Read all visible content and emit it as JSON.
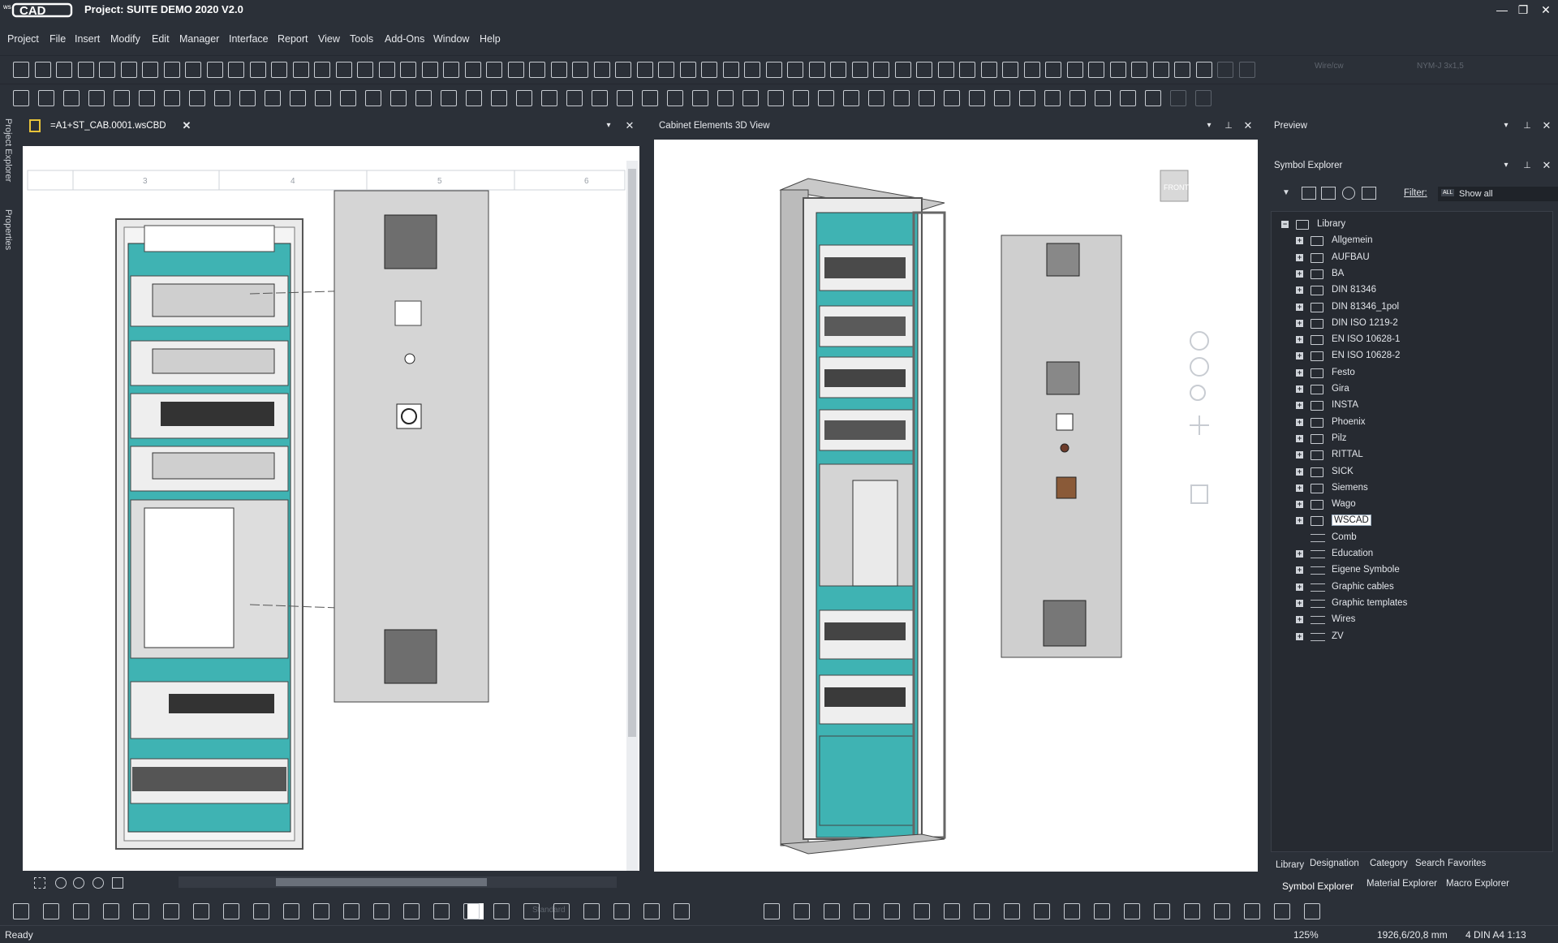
{
  "app": {
    "logo_prefix": "ws",
    "logo_text": "CAD",
    "title": "Project: SUITE DEMO 2020 V2.0"
  },
  "window_controls": {
    "minimize": "—",
    "restore": "❐",
    "close": "✕"
  },
  "menu": [
    "Project",
    "File",
    "Insert",
    "Modify",
    "Edit",
    "Manager",
    "Interface",
    "Report",
    "View",
    "Tools",
    "Add-Ons",
    "Window",
    "Help"
  ],
  "toolbar": {
    "wire_type_placeholder": "Wire/cw",
    "cable_type_placeholder": "NYM-J 3x1,5",
    "layer_placeholder": "Standard"
  },
  "left_dock": {
    "project_explorer": "Project Explorer",
    "properties": "Properties"
  },
  "document": {
    "tab_label": "=A1+ST_CAB.0001.wsCBD",
    "ruler_top": [
      "3",
      "4",
      "5",
      "6"
    ],
    "ruler_inner": [
      "3",
      "4",
      "5",
      "6"
    ]
  },
  "view3d": {
    "title": "Cabinet Elements 3D View",
    "cube_label": "FRONT"
  },
  "preview": {
    "title": "Preview"
  },
  "symbol_explorer": {
    "title": "Symbol Explorer",
    "filter_label": "Filter:",
    "filter_badge": "ALL",
    "filter_value": "Show all",
    "tree": [
      {
        "label": "Library",
        "level": 0,
        "type": "folder",
        "expand": "−"
      },
      {
        "label": "Allgemein",
        "level": 1,
        "type": "folder",
        "expand": "+"
      },
      {
        "label": "AUFBAU",
        "level": 1,
        "type": "folder",
        "expand": "+"
      },
      {
        "label": "BA",
        "level": 1,
        "type": "folder",
        "expand": "+"
      },
      {
        "label": "DIN 81346",
        "level": 1,
        "type": "folder",
        "expand": "+"
      },
      {
        "label": "DIN 81346_1pol",
        "level": 1,
        "type": "folder",
        "expand": "+"
      },
      {
        "label": "DIN ISO 1219-2",
        "level": 1,
        "type": "folder",
        "expand": "+"
      },
      {
        "label": "EN ISO 10628-1",
        "level": 1,
        "type": "folder",
        "expand": "+"
      },
      {
        "label": "EN ISO 10628-2",
        "level": 1,
        "type": "folder",
        "expand": "+"
      },
      {
        "label": "Festo",
        "level": 1,
        "type": "folder",
        "expand": "+"
      },
      {
        "label": "Gira",
        "level": 1,
        "type": "folder",
        "expand": "+"
      },
      {
        "label": "INSTA",
        "level": 1,
        "type": "folder",
        "expand": "+"
      },
      {
        "label": "Phoenix",
        "level": 1,
        "type": "folder",
        "expand": "+"
      },
      {
        "label": "Pilz",
        "level": 1,
        "type": "folder",
        "expand": "+"
      },
      {
        "label": "RITTAL",
        "level": 1,
        "type": "folder",
        "expand": "+"
      },
      {
        "label": "SICK",
        "level": 1,
        "type": "folder",
        "expand": "+"
      },
      {
        "label": "Siemens",
        "level": 1,
        "type": "folder",
        "expand": "+"
      },
      {
        "label": "Wago",
        "level": 1,
        "type": "folder",
        "expand": "+"
      },
      {
        "label": "WSCAD",
        "level": 1,
        "type": "folder",
        "expand": "+",
        "selected": true
      },
      {
        "label": "Comb",
        "level": 1,
        "type": "list",
        "expand": ""
      },
      {
        "label": "Education",
        "level": 1,
        "type": "list",
        "expand": "+"
      },
      {
        "label": "Eigene Symbole",
        "level": 1,
        "type": "list",
        "expand": "+"
      },
      {
        "label": "Graphic cables",
        "level": 1,
        "type": "list",
        "expand": "+"
      },
      {
        "label": "Graphic templates",
        "level": 1,
        "type": "list",
        "expand": "+"
      },
      {
        "label": "Wires",
        "level": 1,
        "type": "list",
        "expand": "+"
      },
      {
        "label": "ZV",
        "level": 1,
        "type": "list",
        "expand": "+"
      }
    ],
    "bottom_tabs": [
      "Library",
      "Designation",
      "Category",
      "Search",
      "Favorites"
    ],
    "explorer_tabs": [
      "Symbol Explorer",
      "Material Explorer",
      "Macro Explorer"
    ]
  },
  "status": {
    "left": "Ready",
    "zoom": "125%",
    "coords": "1926,6/20,8 mm",
    "sheet": "4  DIN A4  1:13"
  },
  "colors": {
    "background": "#2b3038",
    "cabinet_teal": "#3fb3b3",
    "panel_gray": "#d5d5d5"
  }
}
